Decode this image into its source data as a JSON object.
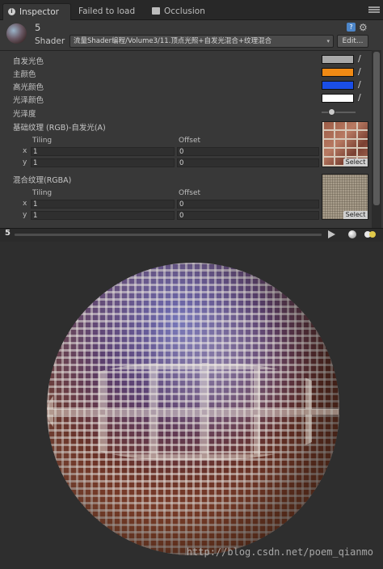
{
  "tabs": {
    "inspector": "Inspector",
    "failed": "Failed to load",
    "occlusion": "Occlusion"
  },
  "header": {
    "material_name": "5",
    "shader_label": "Shader",
    "shader_value": "流量Shader编程/Volume3/11.顶点光照+自发光混合+纹理混合",
    "edit_label": "Edit..."
  },
  "properties": {
    "emission_color": {
      "label": "自发光色",
      "color": "#a8a8a8"
    },
    "main_color": {
      "label": "主颜色",
      "color": "#f08a14"
    },
    "spec_color": {
      "label": "高光颜色",
      "color": "#1a4ee6"
    },
    "gloss_color": {
      "label": "光泽颜色",
      "color": "#ffffff"
    },
    "shininess": {
      "label": "光泽度",
      "value": 0.3
    },
    "base_texture": {
      "label": "基础纹理 (RGB)-自发光(A)",
      "tiling_label": "Tiling",
      "offset_label": "Offset",
      "x_label": "x",
      "y_label": "y",
      "tiling_x": "1",
      "tiling_y": "1",
      "offset_x": "0",
      "offset_y": "0",
      "select_label": "Select"
    },
    "blend_texture": {
      "label": "混合纹理(RGBA)",
      "tiling_label": "Tiling",
      "offset_label": "Offset",
      "x_label": "x",
      "y_label": "y",
      "tiling_x": "1",
      "tiling_y": "1",
      "offset_x": "0",
      "offset_y": "0",
      "select_label": "Select"
    }
  },
  "preview": {
    "name": "5"
  },
  "watermark": "http://blog.csdn.net/poem_qianmo"
}
